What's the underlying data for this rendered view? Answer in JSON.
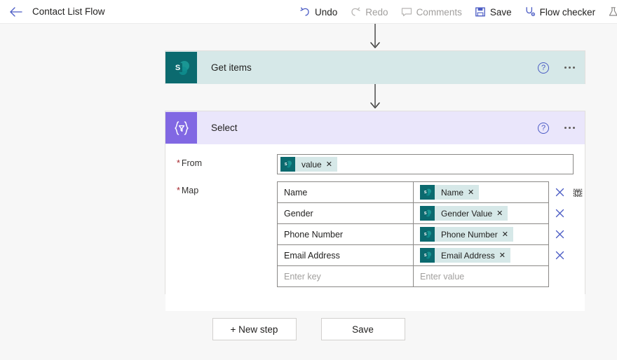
{
  "header": {
    "back_icon": "arrow-left-icon",
    "title": "Contact List Flow",
    "commands": [
      {
        "label": "Undo",
        "icon": "undo-icon",
        "enabled": true
      },
      {
        "label": "Redo",
        "icon": "redo-icon",
        "enabled": false
      },
      {
        "label": "Comments",
        "icon": "comment-icon",
        "enabled": false
      },
      {
        "label": "Save",
        "icon": "save-icon",
        "enabled": true
      },
      {
        "label": "Flow checker",
        "icon": "flow-checker-icon",
        "enabled": true
      },
      {
        "label": "",
        "icon": "flask-test-icon",
        "enabled": true
      }
    ]
  },
  "colors": {
    "sharepoint_teal": "#0b6a6f",
    "sharepoint_card": "#d6e8e8",
    "select_purple": "#8168e3",
    "select_card": "#eae6fb",
    "accent_blue": "#4a5bc4",
    "required_red": "#a4262c",
    "canvas_bg": "#f7f7f7"
  },
  "steps": [
    {
      "name": "Get items",
      "icon": "sharepoint-icon",
      "help_icon": "help-icon",
      "menu_icon": "ellipsis-icon"
    },
    {
      "name": "Select",
      "icon": "select-braces-filter-icon",
      "help_icon": "help-icon",
      "menu_icon": "ellipsis-icon"
    }
  ],
  "select_form": {
    "from": {
      "label": "From",
      "required": true,
      "token": {
        "text": "value",
        "icon": "sharepoint-icon",
        "remove_icon": "close-icon"
      }
    },
    "map": {
      "label": "Map",
      "required": true,
      "rows": [
        {
          "key": "Name",
          "value_token": "Name",
          "token_icon": "sharepoint-icon",
          "has_remove": true,
          "has_text_mode": true
        },
        {
          "key": "Gender",
          "value_token": "Gender Value",
          "token_icon": "sharepoint-icon",
          "has_remove": true,
          "has_text_mode": false
        },
        {
          "key": "Phone Number",
          "value_token": "Phone Number",
          "token_icon": "sharepoint-icon",
          "has_remove": true,
          "has_text_mode": false
        },
        {
          "key": "Email Address",
          "value_token": "Email Address",
          "token_icon": "sharepoint-icon",
          "has_remove": true,
          "has_text_mode": false
        }
      ],
      "new_row": {
        "key_placeholder": "Enter key",
        "value_placeholder": "Enter value"
      }
    }
  },
  "footer": {
    "new_step_label": "+ New step",
    "save_label": "Save"
  }
}
